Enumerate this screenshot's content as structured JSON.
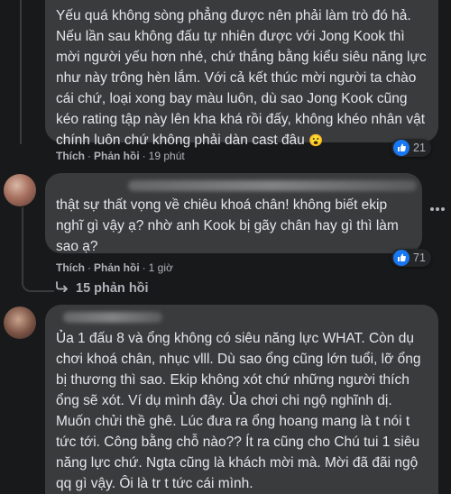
{
  "comments": [
    {
      "text": "Yếu quá không sòng phẳng được nên phải làm trò đó hả. Nếu lần sau không đấu tự nhiên được với Jong Kook thì mời người yếu hơn nhé, chứ thắng bằng kiểu siêu năng lực như này trông hèn lắm. Với cả kết thúc mời người ta chào cái chứ, loại xong bay màu luôn, dù sao Jong Kook cũng kéo rating tập này lên kha khá rồi đấy, không khéo nhân vật chính luôn chứ không phải dàn cast đâu",
      "emoji": "😮",
      "like_label": "Thích",
      "reply_label": "Phản hồi",
      "time": "19 phút",
      "reaction_count": "21"
    },
    {
      "text": "thật sự thất vọng về chiêu khoá chân! không biết ekip nghĩ gì vậy ạ? nhờ anh Kook bị gãy chân hay gì thì làm sao ạ?",
      "like_label": "Thích",
      "reply_label": "Phản hồi",
      "time": "1 giờ",
      "reaction_count": "71",
      "replies_label": "15 phản hồi"
    },
    {
      "text": "Ủa 1 đấu 8 và ổng không có siêu năng lực WHAT. Còn dụ chơi khoá chân, nhục vlll. Dù sao ổng cũng lớn tuổi, lỡ ổng bị thương thì sao. Ekip không xót chứ những người thích ổng sẽ xót. Ví dụ mình đây. Ủa chơi chi ngộ nghĩnh dị. Muốn chửi thề ghê. Lúc đưa ra ổng hoang mang là t nói t tức tới. Công bằng chỗ nào?? Ít ra cũng cho Chú tui 1 siêu năng lực chứ. Ngta cũng là khách mời mà. Mời đã đãi ngộ qq gì vậy. Ôi là tr t tức cái mình."
    }
  ],
  "separator": "·",
  "menu_icon": "more-horizontal-icon",
  "colors": {
    "background": "#18191a",
    "bubble": "#3a3b3c",
    "like_blue": "#1877f2",
    "muted": "#b0b3b8"
  }
}
